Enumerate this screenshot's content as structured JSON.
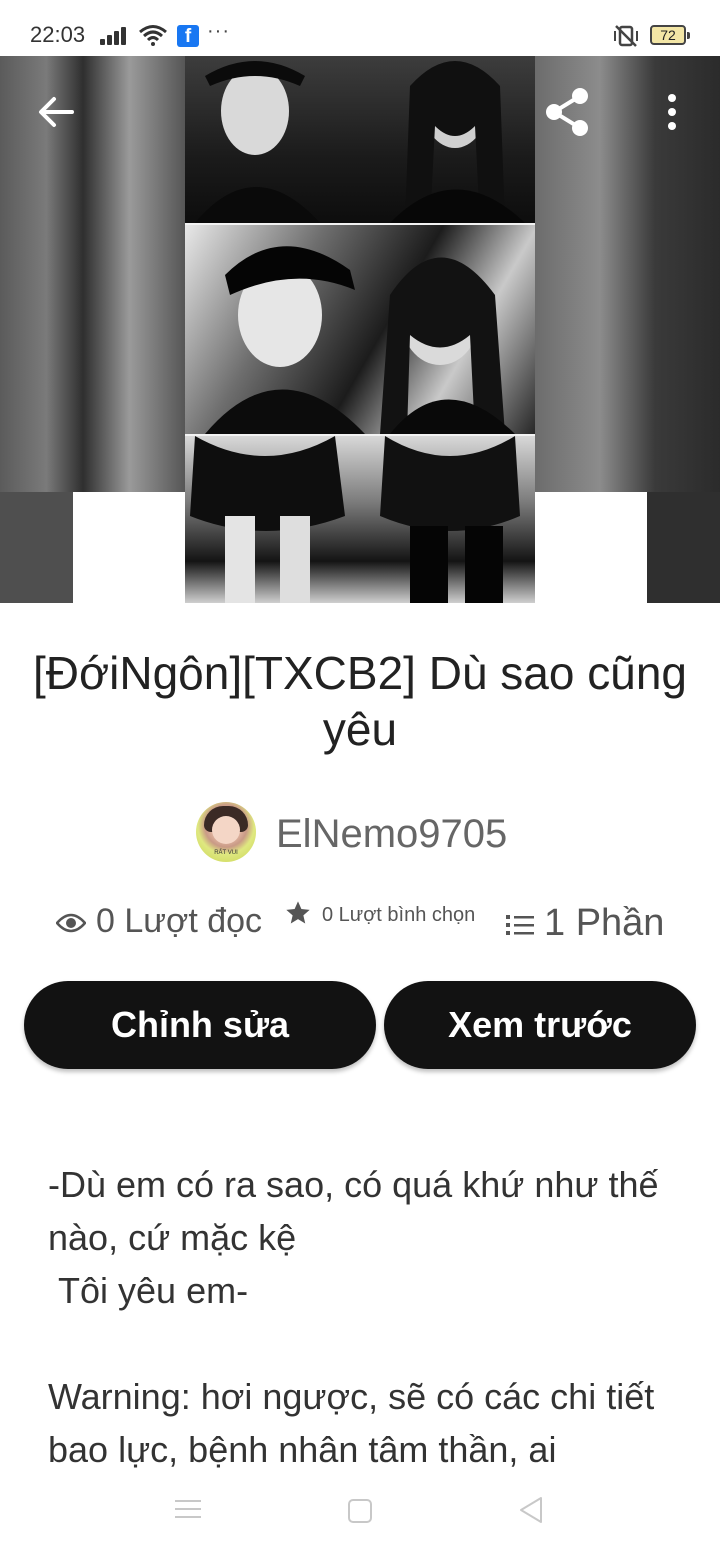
{
  "status_bar": {
    "time": "22:03",
    "notification_icons": [
      "signal-icon",
      "wifi-icon",
      "facebook-icon",
      "more-dots-icon"
    ],
    "more_dots": "···",
    "facebook_glyph": "f",
    "battery_level": "72",
    "status_icons": [
      "vibrate-mute-icon",
      "battery-icon"
    ]
  },
  "toolbar": {
    "back_icon": "arrow-left-icon",
    "share_icon": "share-icon",
    "menu_icon": "more-vert-icon"
  },
  "story": {
    "title": "[ĐớiNgôn][TXCB2] Dù sao cũng yêu",
    "author": "ElNemo9705",
    "avatar_caption": "RẤT VUI",
    "stats": {
      "reads": "0 Lượt đọc",
      "votes": "0 Lượt bình chọn",
      "parts": "1 Phần"
    },
    "description": "-Dù em có ra sao, có quá khứ như thế nào, cứ mặc kệ\n Tôi yêu em-\n\nWarning: hơi ngược, sẽ có các chi tiết bao lực, bệnh nhân tâm thần, ai"
  },
  "actions": {
    "edit_label": "Chỉnh sửa",
    "preview_label": "Xem trước"
  },
  "colors": {
    "button_bg": "#121212",
    "button_text": "#ffffff",
    "title_text": "#222222",
    "muted_text": "#666666"
  },
  "nav_bar": {
    "icons": [
      "recent-apps-icon",
      "home-icon",
      "back-icon"
    ]
  }
}
